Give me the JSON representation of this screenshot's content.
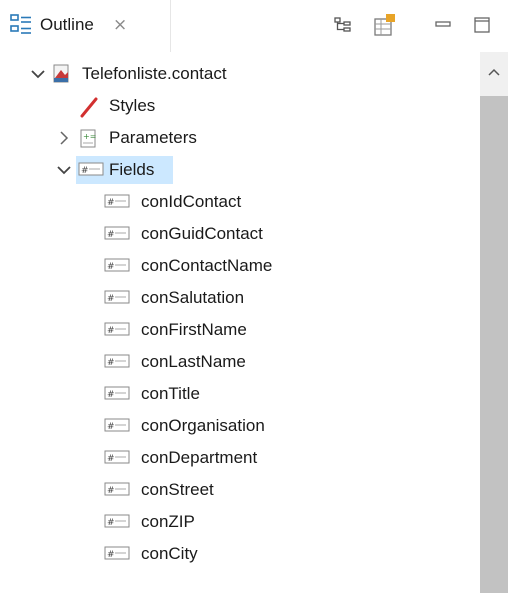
{
  "tab": {
    "title": "Outline",
    "close_glyph": "⨯"
  },
  "toolbar": {
    "buttons": [
      {
        "name": "hierarchy-view-icon"
      },
      {
        "name": "new-element-icon"
      },
      {
        "name": "minimize-icon"
      },
      {
        "name": "maximize-icon"
      }
    ]
  },
  "tree": {
    "root": {
      "label": "Telefonliste.contact",
      "icon": "report-icon",
      "expanded": true
    },
    "children": [
      {
        "label": "Styles",
        "icon": "styles-icon"
      },
      {
        "label": "Parameters",
        "icon": "parameters-icon",
        "expandable": true,
        "expanded": false
      },
      {
        "label": "Fields",
        "icon": "field-icon",
        "expandable": true,
        "expanded": true,
        "selected": true
      }
    ],
    "fields": [
      "conIdContact",
      "conGuidContact",
      "conContactName",
      "conSalutation",
      "conFirstName",
      "conLastName",
      "conTitle",
      "conOrganisation",
      "conDepartment",
      "conStreet",
      "conZIP",
      "conCity"
    ]
  },
  "colors": {
    "selection": "#cce8ff",
    "scrollbar_thumb": "#c2c2c2",
    "outline_icon_blue": "#2a7ab8",
    "toolbar_icon_amber": "#e8a428"
  }
}
